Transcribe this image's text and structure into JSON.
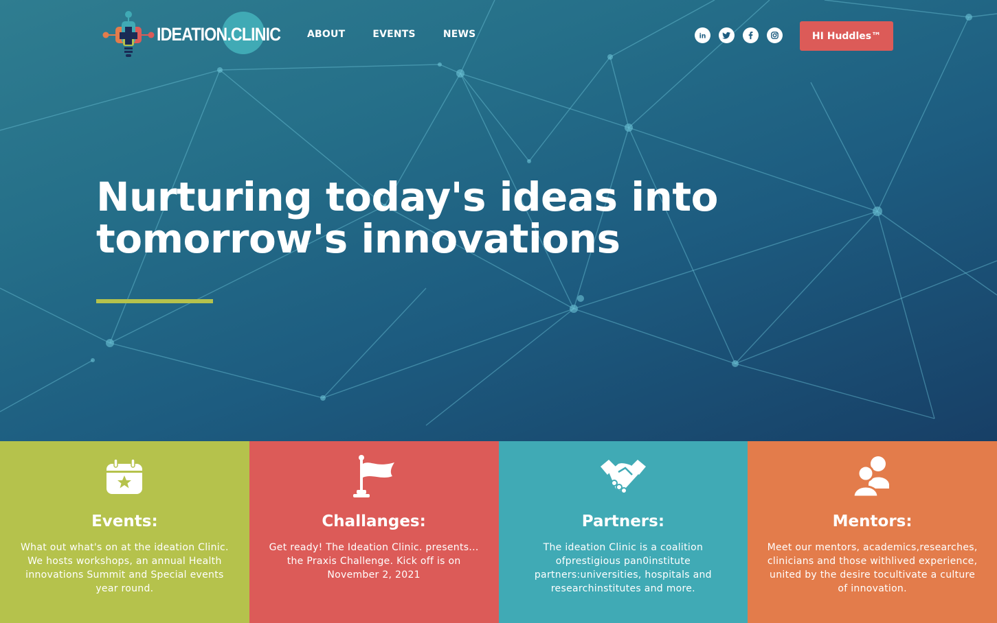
{
  "header": {
    "logo_text": "IDEATION.CLINIC",
    "nav": [
      {
        "label": "ABOUT"
      },
      {
        "label": "EVENTS"
      },
      {
        "label": "NEWS"
      }
    ],
    "social_icons": [
      "linkedin-icon",
      "twitter-icon",
      "facebook-icon",
      "instagram-icon"
    ],
    "cta_label": "HI Huddles™"
  },
  "hero": {
    "headline_line1": "Nurturing today's ideas into",
    "headline_line2": "tomorrow's innovations"
  },
  "cards": [
    {
      "icon": "calendar-star-icon",
      "title": "Events:",
      "description": "What out what's on at the ideation Clinic. We hosts workshops, an annual Health innovations Summit and Special events year round.",
      "color": "#b5c24c"
    },
    {
      "icon": "flag-icon",
      "title": "Challanges:",
      "description": "Get ready! The Ideation Clinic. presents... the Praxis Challenge. Kick off is on November 2, 2021",
      "color": "#dc5b58"
    },
    {
      "icon": "handshake-icon",
      "title": "Partners:",
      "description": "The ideation Clinic is a coalition ofprestigious pan0institute partners:universities, hospitals and researchinstitutes and more.",
      "color": "#40aab5"
    },
    {
      "icon": "people-icon",
      "title": "Mentors:",
      "description": "Meet our mentors, academics,researches, clinicians and those withlived experience, united by the desire tocultivate a culture of innovation.",
      "color": "#e37c4b"
    }
  ],
  "colors": {
    "accent_bar": "#b5c24c",
    "cta": "#dc5b58"
  }
}
